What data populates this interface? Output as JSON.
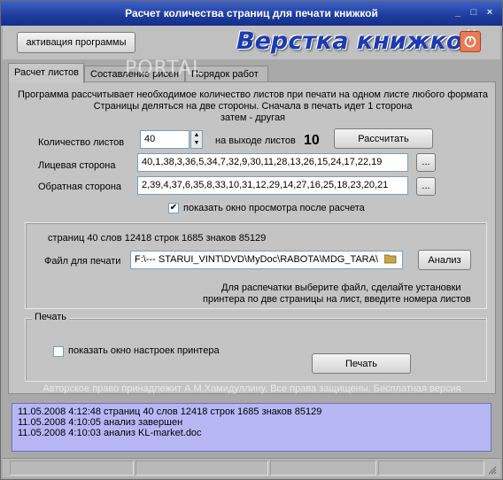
{
  "window": {
    "title": "Расчет количества страниц для печати книжкой",
    "controls": [
      "minimize-icon",
      "maximize-icon",
      "close-icon"
    ]
  },
  "toolbar": {
    "activate_label": "активация программы",
    "logo_text": "Верстка книжкой",
    "power_icon": "power-icon",
    "logo_color": "#1c3bb3"
  },
  "tabs": [
    {
      "label": "Расчет листов",
      "active": true
    },
    {
      "label": "Составление рисен",
      "active": false
    },
    {
      "label": "Порядок работ",
      "active": false
    }
  ],
  "watermark": "PORTAL",
  "description": {
    "line1": "Программа рассчитывает необходимое количество листов при печати на одном листе  любого формата",
    "line2": "Страницы деляться на две стороны. Сначала в печать идет 1 сторона",
    "line3": "затем - другая"
  },
  "calc": {
    "pages_label": "Количество листов",
    "pages_value": "40",
    "output_label": "на выходе листов",
    "output_value": "10",
    "calculate_label": "Рассчитать"
  },
  "front": {
    "label": "Лицевая сторона",
    "value": "40,1,38,3,36,5,34,7,32,9,30,11,28,13,26,15,24,17,22,19",
    "button": "..."
  },
  "back": {
    "label": "Обратная сторона",
    "value": "2,39,4,37,6,35,8,33,10,31,12,29,14,27,16,25,18,23,20,21",
    "button": "..."
  },
  "preview_check": {
    "label": "показать окно просмотра после расчета",
    "checked": true
  },
  "file": {
    "stats": "страниц 40 слов 12418 строк 1685 знаков 85129",
    "label": "Файл для печати",
    "path": "F:\\---   STARUI_VINT\\DVD\\MyDoc\\RABOTA\\MDG_TARA\\",
    "folder_icon": "folder-icon",
    "analyze_label": "Анализ",
    "hint1": "Для распечатки выберите файл, сделайте установки",
    "hint2": "принтера по две страницы на лист, введите номера листов"
  },
  "print": {
    "group_label": "Печать",
    "printer_check_label": "показать окно настроек принтера",
    "printer_check_checked": false,
    "print_button": "Печать"
  },
  "copyright": "Авторское право принадлежит А.М.Хамидуллину. Все права защищены. Бесплатная версия",
  "log": [
    "11.05.2008 4:12:48 страниц 40 слов 12418 строк 1685 знаков 85129",
    "11.05.2008 4:10:05 анализ завершен",
    "11.05.2008 4:10:03 анализ KL-market.doc"
  ]
}
